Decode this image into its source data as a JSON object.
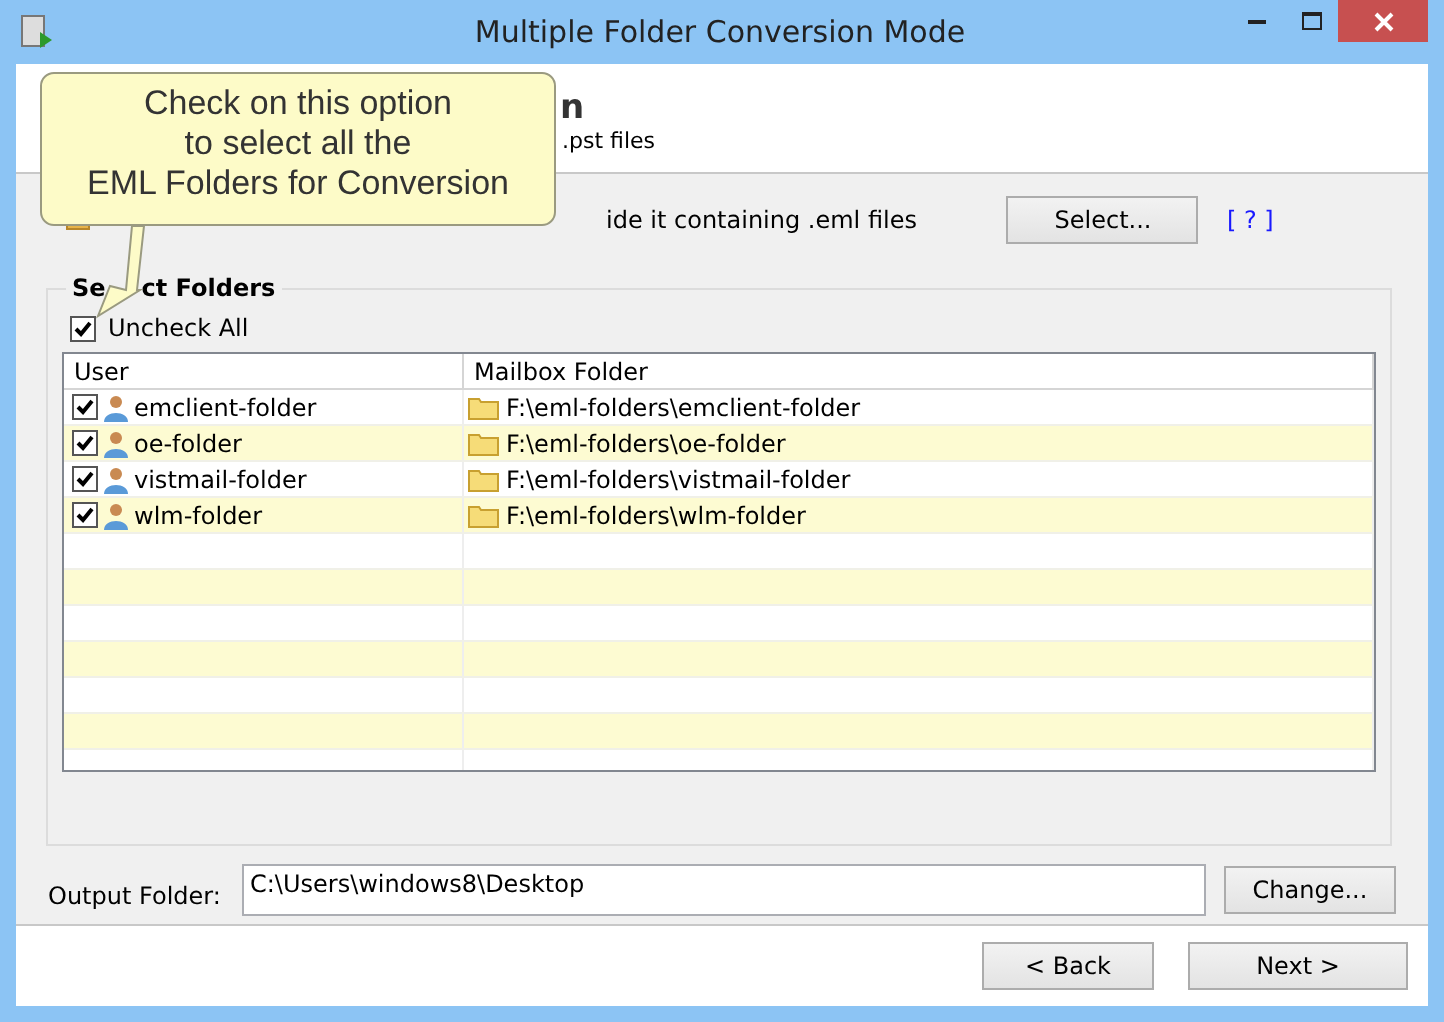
{
  "window": {
    "title": "Multiple Folder Conversion Mode"
  },
  "header": {
    "title_fragment": "n",
    "subtitle_fragment": ".pst files"
  },
  "callout": {
    "text": [
      "Check on this option",
      "to select all the",
      "EML Folders for Conversion"
    ]
  },
  "source": {
    "label_fragment": "ide it containing .eml files",
    "select_button": "Select...",
    "help_link": "[ ? ]"
  },
  "group": {
    "title": [
      "Se",
      "ct Folders"
    ],
    "check_all": {
      "label": "Uncheck All",
      "checked": true
    }
  },
  "table": {
    "columns": [
      "User",
      "Mailbox Folder"
    ],
    "rows": [
      {
        "checked": true,
        "user": "emclient-folder",
        "folder": "F:\\eml-folders\\emclient-folder"
      },
      {
        "checked": true,
        "user": "oe-folder",
        "folder": "F:\\eml-folders\\oe-folder"
      },
      {
        "checked": true,
        "user": "vistmail-folder",
        "folder": "F:\\eml-folders\\vistmail-folder"
      },
      {
        "checked": true,
        "user": "wlm-folder",
        "folder": "F:\\eml-folders\\wlm-folder"
      }
    ]
  },
  "output": {
    "label": "Output Folder:",
    "value": "C:\\Users\\windows8\\Desktop",
    "button": "Change..."
  },
  "footer": {
    "back": "< Back",
    "next": "Next >"
  }
}
